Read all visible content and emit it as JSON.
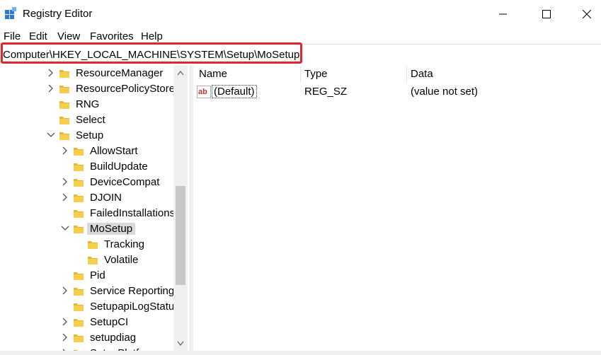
{
  "window": {
    "title": "Registry Editor"
  },
  "menu": [
    "File",
    "Edit",
    "View",
    "Favorites",
    "Help"
  ],
  "address": {
    "path": "Computer\\HKEY_LOCAL_MACHINE\\SYSTEM\\Setup\\MoSetup"
  },
  "tree": [
    {
      "label": "ResourceManager",
      "level": 0,
      "expander": "collapsed"
    },
    {
      "label": "ResourcePolicyStore",
      "level": 0,
      "expander": "collapsed"
    },
    {
      "label": "RNG",
      "level": 0,
      "expander": "none"
    },
    {
      "label": "Select",
      "level": 0,
      "expander": "none"
    },
    {
      "label": "Setup",
      "level": 0,
      "expander": "expanded"
    },
    {
      "label": "AllowStart",
      "level": 1,
      "expander": "collapsed"
    },
    {
      "label": "BuildUpdate",
      "level": 1,
      "expander": "none"
    },
    {
      "label": "DeviceCompat",
      "level": 1,
      "expander": "collapsed"
    },
    {
      "label": "DJOIN",
      "level": 1,
      "expander": "collapsed"
    },
    {
      "label": "FailedInstallations",
      "level": 1,
      "expander": "none"
    },
    {
      "label": "MoSetup",
      "level": 1,
      "expander": "expanded",
      "selected": true
    },
    {
      "label": "Tracking",
      "level": 2,
      "expander": "none"
    },
    {
      "label": "Volatile",
      "level": 2,
      "expander": "none"
    },
    {
      "label": "Pid",
      "level": 1,
      "expander": "none"
    },
    {
      "label": "Service Reporting",
      "level": 1,
      "expander": "collapsed"
    },
    {
      "label": "SetupapiLogStatu",
      "level": 1,
      "expander": "none"
    },
    {
      "label": "SetupCI",
      "level": 1,
      "expander": "collapsed"
    },
    {
      "label": "setupdiag",
      "level": 1,
      "expander": "collapsed"
    },
    {
      "label": "SetupPlatform",
      "level": 1,
      "expander": "collapsed"
    }
  ],
  "values": {
    "columns": [
      "Name",
      "Type",
      "Data"
    ],
    "rows": [
      {
        "name": "(Default)",
        "type": "REG_SZ",
        "data": "(value not set)",
        "icon": "string-value-icon"
      }
    ]
  },
  "colors": {
    "highlight_border": "#e3262c",
    "folder": "#e8b731",
    "selection": "#d9d9d9"
  }
}
